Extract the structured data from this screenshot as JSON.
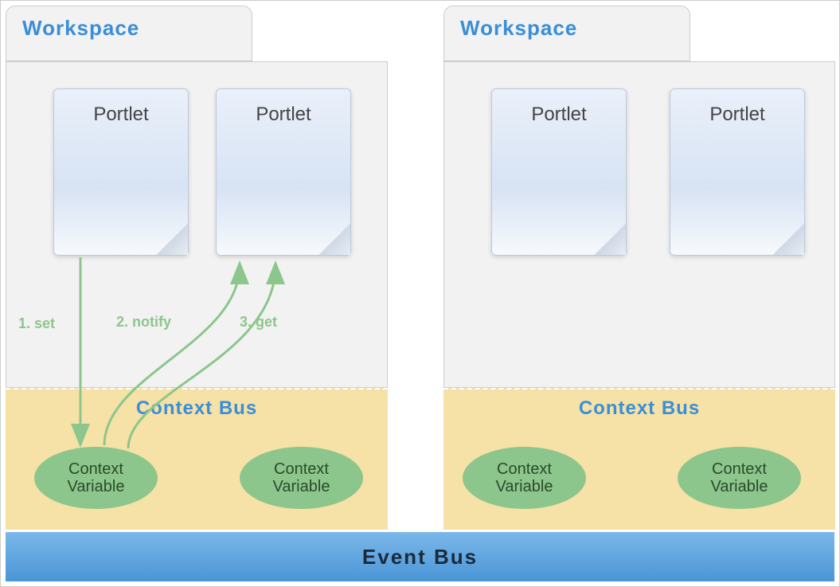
{
  "workspaces": [
    {
      "title": "Workspace",
      "portlets": [
        "Portlet",
        "Portlet"
      ]
    },
    {
      "title": "Workspace",
      "portlets": [
        "Portlet",
        "Portlet"
      ]
    }
  ],
  "contextBus": {
    "title": "Context Bus",
    "variables": [
      "Context\nVariable",
      "Context\nVariable",
      "Context\nVariable",
      "Context\nVariable"
    ]
  },
  "eventBus": {
    "title": "Event Bus"
  },
  "flowLabels": {
    "set": "1. set",
    "notify": "2. notify",
    "get": "3. get"
  }
}
